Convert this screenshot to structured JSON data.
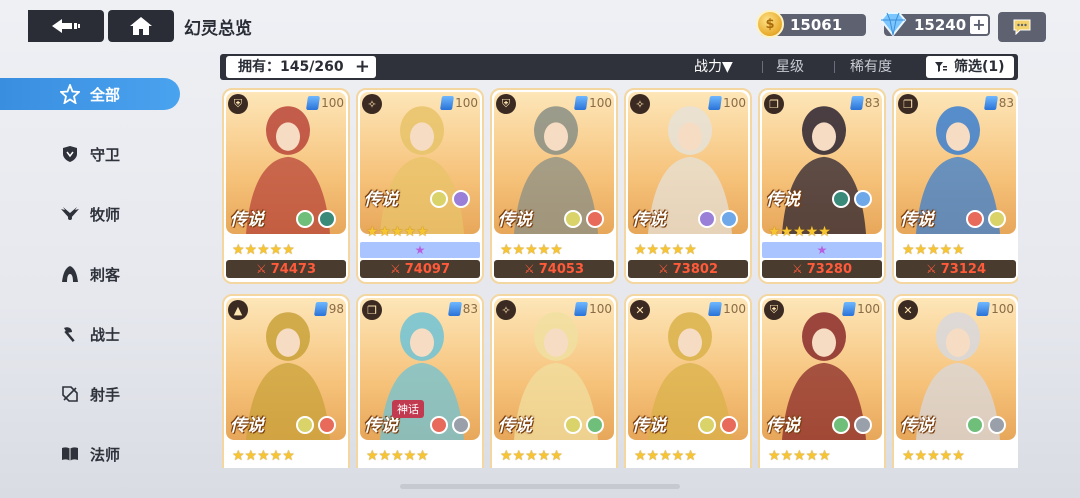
{
  "header": {
    "title": "幻灵总览",
    "gold": "15061",
    "gems": "15240",
    "plus": "+"
  },
  "filterbar": {
    "owned": "拥有：145/260",
    "sort_power": "战力▼",
    "sort_star": "星级",
    "sort_rarity": "稀有度",
    "filter": "筛选(1)"
  },
  "sidebar": {
    "items": [
      {
        "label": "全部",
        "icon": "all-star-icon"
      },
      {
        "label": "守卫",
        "icon": "shield-icon"
      },
      {
        "label": "牧师",
        "icon": "wings-icon"
      },
      {
        "label": "刺客",
        "icon": "hood-icon"
      },
      {
        "label": "战士",
        "icon": "axe-icon"
      },
      {
        "label": "射手",
        "icon": "bow-icon"
      },
      {
        "label": "法师",
        "icon": "book-icon"
      }
    ]
  },
  "cards": [
    {
      "level": "100",
      "rarity": "传说",
      "stars": "★★★★★",
      "power": "74473",
      "bond": false,
      "class_icon": "shield-icon",
      "colors": [
        "#6fbf7a",
        "#3a8a7a"
      ]
    },
    {
      "level": "100",
      "rarity": "传说",
      "stars": "★★★★★",
      "power": "74097",
      "bond": true,
      "bond_icon": "★",
      "class_icon": "wings-icon",
      "colors": [
        "#d9d36a",
        "#9a7fd8"
      ]
    },
    {
      "level": "100",
      "rarity": "传说",
      "stars": "★★★★★",
      "power": "74053",
      "bond": false,
      "class_icon": "shield-icon",
      "colors": [
        "#d9d36a",
        "#e86a5a"
      ]
    },
    {
      "level": "100",
      "rarity": "传说",
      "stars": "★★★★★",
      "power": "73802",
      "bond": false,
      "class_icon": "wings-icon",
      "colors": [
        "#9a7fd8",
        "#6fa8e8"
      ]
    },
    {
      "level": "83",
      "rarity": "传说",
      "stars": "★★★★★",
      "power": "73280",
      "bond": true,
      "bond_icon": "★",
      "class_icon": "book-icon",
      "colors": [
        "#3a8a7a",
        "#6fa8e8"
      ]
    },
    {
      "level": "83",
      "rarity": "传说",
      "stars": "★★★★★",
      "power": "73124",
      "bond": false,
      "class_icon": "book-icon",
      "colors": [
        "#e86a5a",
        "#d9d36a"
      ]
    },
    {
      "level": "98",
      "rarity": "传说",
      "stars": "★★★★★",
      "power": "",
      "bond": false,
      "class_icon": "hood-icon",
      "colors": [
        "#d9d36a",
        "#e86a5a"
      ]
    },
    {
      "level": "83",
      "rarity": "传说",
      "stars": "★★★★★",
      "power": "",
      "bond": false,
      "mythic": "神话",
      "class_icon": "book-icon",
      "colors": [
        "#e86a5a",
        "#9aa0aa"
      ]
    },
    {
      "level": "100",
      "rarity": "传说",
      "stars": "★★★★★",
      "power": "",
      "bond": false,
      "class_icon": "wings-icon",
      "colors": [
        "#d9d36a",
        "#6fbf7a"
      ]
    },
    {
      "level": "100",
      "rarity": "传说",
      "stars": "★★★★★",
      "power": "",
      "bond": false,
      "class_icon": "bow-icon",
      "colors": [
        "#d9d36a",
        "#e86a5a"
      ]
    },
    {
      "level": "100",
      "rarity": "传说",
      "stars": "★★★★★",
      "power": "",
      "bond": false,
      "class_icon": "shield-icon",
      "colors": [
        "#6fbf7a",
        "#9aa0aa"
      ]
    },
    {
      "level": "100",
      "rarity": "传说",
      "stars": "★★★★★",
      "power": "",
      "bond": false,
      "class_icon": "bow-icon",
      "colors": [
        "#6fbf7a",
        "#9aa0aa"
      ]
    }
  ],
  "accent": "#3a8ee0"
}
